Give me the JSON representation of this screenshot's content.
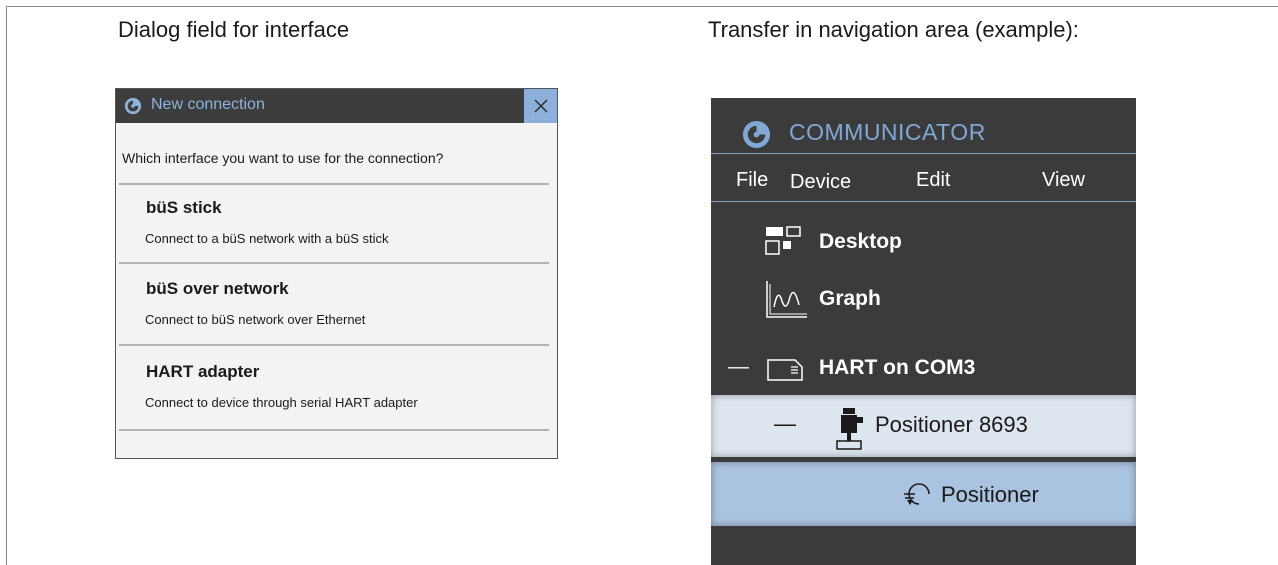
{
  "captions": {
    "left": "Dialog field for interface",
    "right": "Transfer in navigation area (example):"
  },
  "dialog": {
    "title": "New connection",
    "question": "Which interface you want to use for the connection?",
    "options": [
      {
        "name": "büS stick",
        "description": "Connect to a büS network with a büS stick"
      },
      {
        "name": "büS over network",
        "description": "Connect to büS network over Ethernet"
      },
      {
        "name": "HART adapter",
        "description": "Connect to device through serial HART adapter"
      }
    ],
    "icons": {
      "logo": "communicator-logo-icon",
      "close": "close-icon"
    },
    "colors": {
      "title_bar": "#3d3d3d",
      "title_text": "#8db3dd",
      "close_bg": "#8cb0d9",
      "body": "#f3f3f3"
    }
  },
  "navigation": {
    "app_title": "COMMUNICATOR",
    "menu": [
      "File",
      "Device",
      "Edit",
      "View"
    ],
    "items": [
      {
        "label": "Desktop",
        "icon": "desktop-icon"
      },
      {
        "label": "Graph",
        "icon": "graph-icon"
      },
      {
        "label": "HART on COM3",
        "icon": "interface-icon",
        "expander": "—"
      },
      {
        "label": "Positioner 8693",
        "icon": "device-icon",
        "expander": "—"
      },
      {
        "label": "Positioner",
        "icon": "positioner-icon"
      }
    ],
    "colors": {
      "background": "#3b3b3b",
      "accent": "#7fa8d6",
      "row_device": "#dde5ef",
      "row_selected": "#aac3e0"
    }
  }
}
